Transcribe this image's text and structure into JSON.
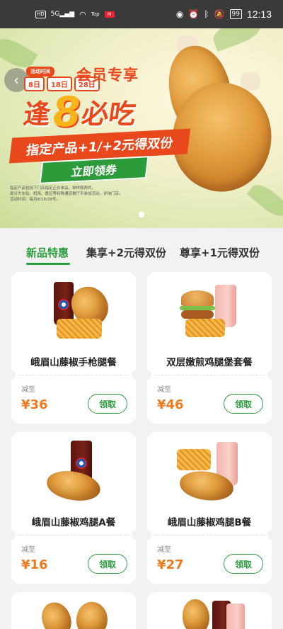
{
  "status_bar": {
    "time": "12:13",
    "battery": "99",
    "left_chip": "HD",
    "signal": "5G",
    "net_label": "Top",
    "red_chip": "M"
  },
  "banner": {
    "badge": "活动时间",
    "dates": [
      "8日",
      "18日",
      "28日"
    ],
    "member_title": "会员专享",
    "feng": "逢",
    "eight": "8",
    "bichi": "必吃",
    "slogan": "指定产品+1/+2元得双份",
    "claim_button": "立即领券",
    "fineprint": [
      "指定产品包括下门店指定正价单品，单样限两件。",
      "部分大车站、机场、景区等特殊通道餐厅不参加活动，详询门店。",
      "活动时间：每月8/18/28号。"
    ]
  },
  "tabs": [
    {
      "label": "新品特惠",
      "active": true
    },
    {
      "label": "集享+2元得双份",
      "active": false
    },
    {
      "label": "尊享+1元得双份",
      "active": false
    }
  ],
  "cards": [
    {
      "name": "峨眉山藤椒手枪腿餐",
      "price_label": "减至",
      "price": "¥36",
      "button": "领取"
    },
    {
      "name": "双层嫩煎鸡腿堡套餐",
      "price_label": "减至",
      "price": "¥46",
      "button": "领取"
    },
    {
      "name": "峨眉山藤椒鸡腿A餐",
      "price_label": "减至",
      "price": "¥16",
      "button": "领取"
    },
    {
      "name": "峨眉山藤椒鸡腿B餐",
      "price_label": "减至",
      "price": "¥27",
      "button": "领取"
    }
  ],
  "colors": {
    "brand_green": "#2a9a3c",
    "price_orange": "#f07b1c",
    "promo_red": "#e8481c"
  }
}
